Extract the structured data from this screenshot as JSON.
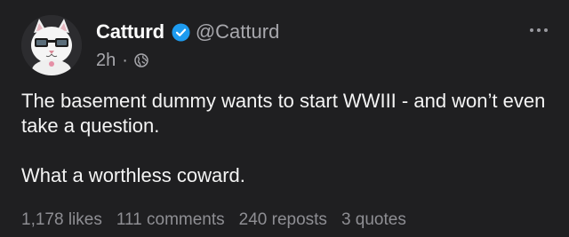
{
  "author": {
    "display_name": "Catturd",
    "handle": "@Catturd",
    "verified": true,
    "verified_color": "#1d9bf0"
  },
  "meta": {
    "time": "2h",
    "separator": "·",
    "visibility_icon": "globe-icon"
  },
  "post": {
    "paragraphs": [
      "The basement dummy wants to start WWIII - and won’t even take a question.",
      "What a worthless coward."
    ]
  },
  "stats": {
    "likes": "1,178 likes",
    "comments": "111 comments",
    "reposts": "240 reposts",
    "quotes": "3 quotes"
  },
  "colors": {
    "background": "#1f1f21",
    "text": "#f4f4f4",
    "muted": "#a8a8ad"
  }
}
